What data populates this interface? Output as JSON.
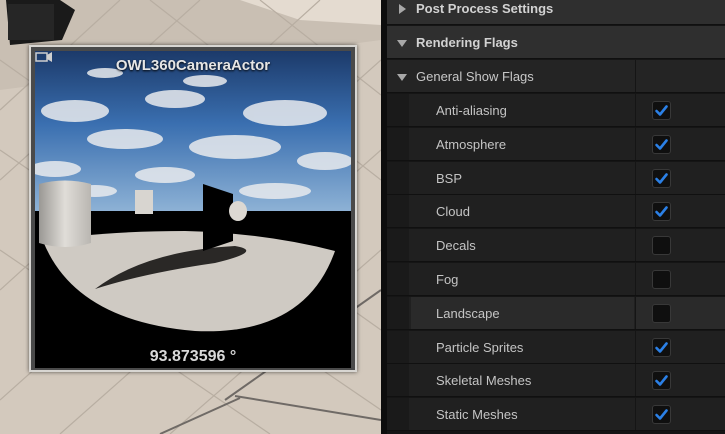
{
  "preview": {
    "title": "OWL360CameraActor",
    "readout": "93.873596 °"
  },
  "details": {
    "categories": [
      {
        "label": "Post Process Settings",
        "expanded": false
      },
      {
        "label": "Rendering Flags",
        "expanded": true
      }
    ],
    "subcategory": {
      "label": "General Show Flags",
      "expanded": true
    },
    "flags": [
      {
        "label": "Anti-aliasing",
        "checked": true
      },
      {
        "label": "Atmosphere",
        "checked": true
      },
      {
        "label": "BSP",
        "checked": true
      },
      {
        "label": "Cloud",
        "checked": true
      },
      {
        "label": "Decals",
        "checked": false
      },
      {
        "label": "Fog",
        "checked": false
      },
      {
        "label": "Landscape",
        "checked": false
      },
      {
        "label": "Particle Sprites",
        "checked": true
      },
      {
        "label": "Skeletal Meshes",
        "checked": true
      },
      {
        "label": "Static Meshes",
        "checked": true
      }
    ]
  },
  "colors": {
    "check_accent": "#2b80e6",
    "panel_bg": "#151515",
    "viewport_floor": "#d6cdc2"
  },
  "icons": {
    "collapsed": "triangle-right-icon",
    "expanded": "triangle-down-icon",
    "checked": "checkmark-icon",
    "camera": "camera-icon"
  }
}
